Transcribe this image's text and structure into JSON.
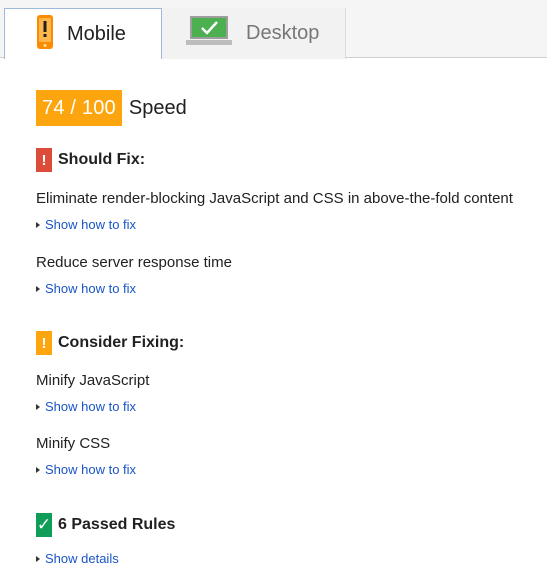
{
  "tabs": [
    {
      "label": "Mobile",
      "icon": "mobile-phone-icon",
      "active": true
    },
    {
      "label": "Desktop",
      "icon": "desktop-monitor-icon",
      "active": false
    }
  ],
  "score": {
    "value": "74 / 100",
    "label": "Speed"
  },
  "should_fix": {
    "title": "Should Fix:",
    "badge": "!",
    "rules": [
      {
        "text": "Eliminate render-blocking JavaScript and CSS in above-the-fold content",
        "link": "Show how to fix"
      },
      {
        "text": "Reduce server response time",
        "link": "Show how to fix"
      }
    ]
  },
  "consider_fixing": {
    "title": "Consider Fixing:",
    "badge": "!",
    "rules": [
      {
        "text": "Minify JavaScript",
        "link": "Show how to fix"
      },
      {
        "text": "Minify CSS",
        "link": "Show how to fix"
      }
    ]
  },
  "passed": {
    "title": "6 Passed Rules",
    "badge": "✓",
    "link": "Show details"
  },
  "colors": {
    "accent": "#fca50e",
    "error": "#dd4b39",
    "pass": "#0f9d58",
    "link": "#1a55c7"
  }
}
